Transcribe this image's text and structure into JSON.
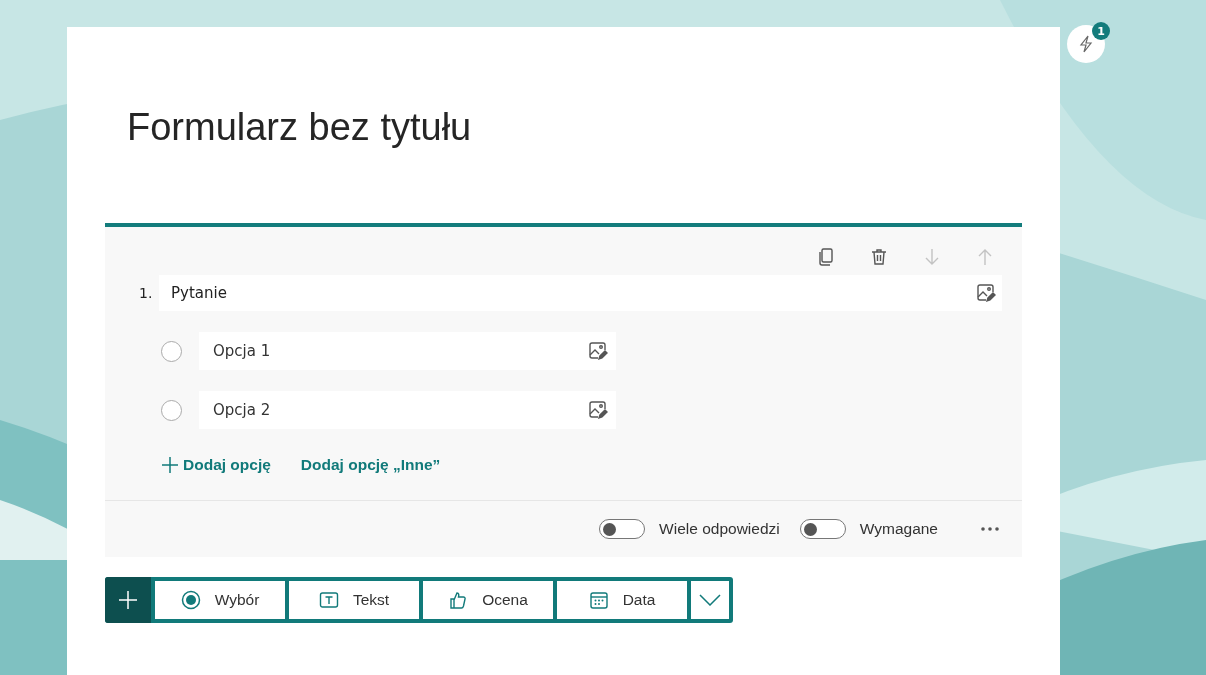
{
  "notifications": {
    "count": "1"
  },
  "form": {
    "title": "Formularz bez tytułu"
  },
  "question": {
    "actions": [
      {
        "kind": "copy",
        "disabled": false
      },
      {
        "kind": "delete",
        "disabled": false
      },
      {
        "kind": "down",
        "disabled": true
      },
      {
        "kind": "up",
        "disabled": true
      }
    ],
    "number": "1.",
    "text": "Pytanie",
    "options": [
      {
        "text": "Opcja 1",
        "selected": false
      },
      {
        "text": "Opcja 2",
        "selected": false
      }
    ],
    "add_option": "Dodaj opcję",
    "add_other": "Dodaj opcję „Inne”",
    "toggles": [
      {
        "label": "Wiele odpowiedzi",
        "on": false
      },
      {
        "label": "Wymagane",
        "on": false
      }
    ]
  },
  "insert_bar": [
    {
      "kind": "choice",
      "label": "Wybór"
    },
    {
      "kind": "text",
      "label": "Tekst"
    },
    {
      "kind": "rating",
      "label": "Ocena"
    },
    {
      "kind": "date",
      "label": "Data"
    }
  ]
}
